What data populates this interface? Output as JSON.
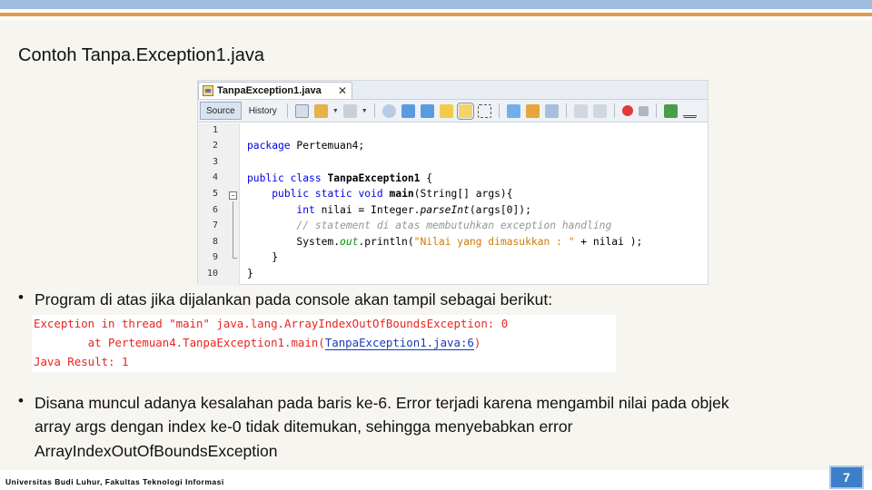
{
  "slide": {
    "title": "Contoh Tanpa.Exception1.java",
    "footer": "Universitas Budi Luhur, Fakultas Teknologi Informasi",
    "page_number": "7"
  },
  "ide": {
    "file_tab": "TanpaException1.java",
    "close_label": "✕",
    "views": [
      "Source",
      "History"
    ],
    "line_numbers": [
      "1",
      "2",
      "3",
      "4",
      "5",
      "6",
      "7",
      "8",
      "9",
      "10"
    ],
    "code": {
      "l2_kw": "package",
      "l2_rest": " Pertemuan4;",
      "l4_kw1": "public",
      "l4_kw2": "class",
      "l4_name": "TanpaException1",
      "l4_rest": " {",
      "l5_kw1": "public",
      "l5_kw2": "static",
      "l5_kw3": "void",
      "l5_name": "main",
      "l5_rest": "(String[] args){",
      "l6_kw": "int",
      "l6_a": " nilai = Integer.",
      "l6_method": "parseInt",
      "l6_b": "(args[0]);",
      "l7_comment": "// statement di atas membutuhkan exception handling",
      "l8_a": "System.",
      "l8_field": "out",
      "l8_b": ".println(",
      "l8_str": "\"Nilai yang dimasukkan : \"",
      "l8_c": " + nilai );",
      "l9": "}",
      "l10": "}"
    },
    "colors": {
      "keyword": "#0000e6",
      "comment": "#969696",
      "string": "#ce7b00",
      "field": "#009900"
    }
  },
  "bullets": {
    "b1": "Program di atas jika dijalankan pada console akan tampil sebagai berikut:",
    "b2_line1": "Disana muncul adanya kesalahan pada baris ke-6. Error terjadi karena mengambil nilai pada objek",
    "b2_line2": "array args dengan index ke-0 tidak ditemukan, sehingga menyebabkan error",
    "b2_line3": "ArrayIndexOutOfBoundsException",
    "marker": "•"
  },
  "console": {
    "line1": "Exception in thread \"main\" java.lang.ArrayIndexOutOfBoundsException: 0",
    "line2_prefix": "        at Pertemuan4.TanpaException1.main(",
    "line2_link": "TanpaException1.java:6",
    "line2_suffix": ")",
    "line3": "Java Result: 1",
    "colors": {
      "error": "#e8251f",
      "link": "#1a3ab8"
    }
  }
}
